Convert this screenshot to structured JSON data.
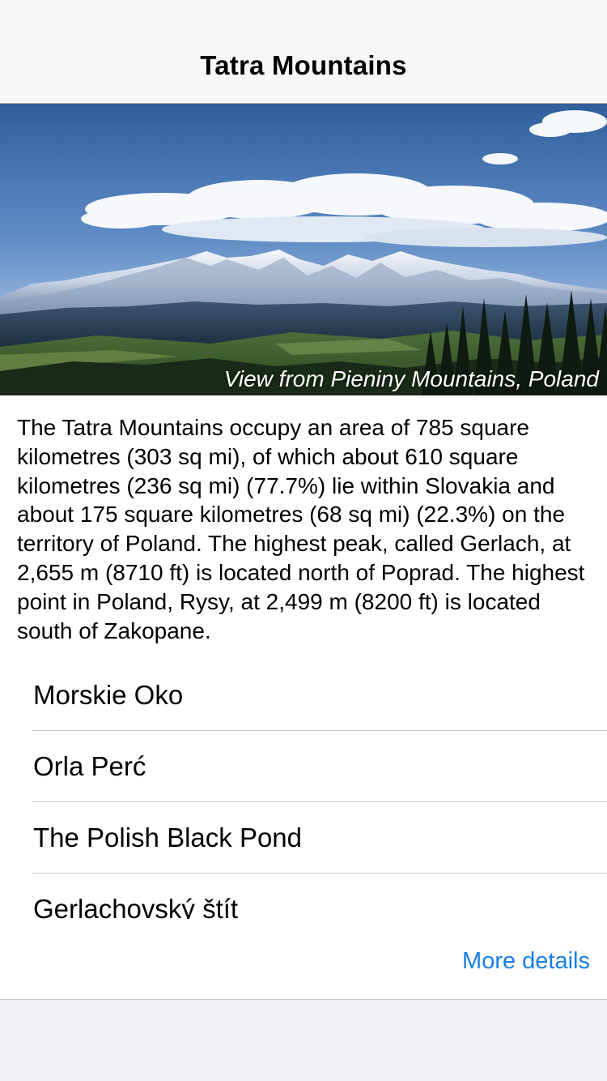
{
  "navbar": {
    "title": "Tatra Mountains"
  },
  "hero": {
    "caption": "View from Pieniny Mountains, Poland"
  },
  "description": "The Tatra Mountains occupy an area of 785 square kilometres (303 sq mi), of which about 610 square kilometres (236 sq mi) (77.7%) lie within Slovakia and about 175 square kilometres (68 sq mi) (22.3%) on the territory of Poland. The highest peak, called Gerlach, at 2,655 m (8710 ft) is located north of Poprad. The highest point in Poland, Rysy, at 2,499 m (8200 ft) is located south of Zakopane.",
  "places": [
    {
      "label": "Morskie Oko"
    },
    {
      "label": "Orla Perć"
    },
    {
      "label": "The Polish Black Pond"
    },
    {
      "label": "Gerlachovský štít"
    }
  ],
  "more_details_label": "More details",
  "colors": {
    "link": "#1a7ee6",
    "navbar_bg": "#f7f7f7",
    "page_bg": "#efeff4"
  }
}
